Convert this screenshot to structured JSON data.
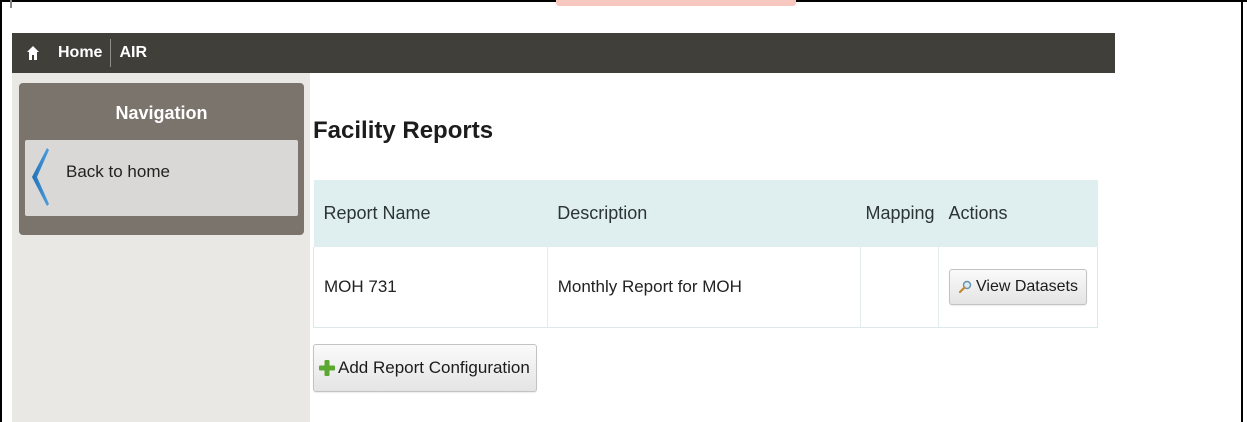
{
  "breadcrumb": {
    "home_label": "Home",
    "current_label": "AIR"
  },
  "sidebar": {
    "title": "Navigation",
    "back_label": "Back to home"
  },
  "main": {
    "title": "Facility Reports",
    "table": {
      "headers": [
        "Report Name",
        "Description",
        "Mapping",
        "Actions"
      ],
      "rows": [
        {
          "report_name": "MOH 731",
          "description": "Monthly Report for MOH",
          "mapping": "",
          "action_label": "View Datasets"
        }
      ]
    },
    "add_button_label": "Add Report Configuration"
  },
  "icons": {
    "home": "home-icon",
    "back": "chevron-left-icon",
    "view": "magnifier-icon",
    "add": "plus-icon"
  },
  "colors": {
    "topbar": "#403f39",
    "nav_panel": "#7b746c",
    "table_header": "#dfefef",
    "add_plus": "#5aa832"
  }
}
